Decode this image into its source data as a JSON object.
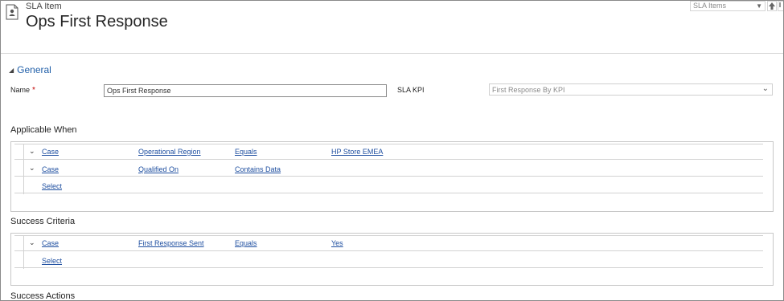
{
  "header": {
    "entity_type": "SLA Item",
    "title": "Ops First Response",
    "nav_selector": "SLA Items",
    "icon": "document-person-icon"
  },
  "general": {
    "section_label": "General",
    "name_label": "Name",
    "required_marker": "*",
    "name_value": "Ops First Response",
    "sla_kpi_label": "SLA KPI",
    "sla_kpi_value": "First Response By KPI"
  },
  "applicable_when": {
    "title": "Applicable When",
    "rows": [
      {
        "entity": "Case",
        "field": "Operational Region",
        "operator": "Equals",
        "value": "HP Store EMEA"
      },
      {
        "entity": "Case",
        "field": "Qualified On",
        "operator": "Contains Data",
        "value": ""
      }
    ],
    "select_label": "Select"
  },
  "success_criteria": {
    "title": "Success Criteria",
    "rows": [
      {
        "entity": "Case",
        "field": "First Response Sent",
        "operator": "Equals",
        "value": "Yes"
      }
    ],
    "select_label": "Select"
  },
  "success_actions": {
    "title": "Success Actions"
  },
  "colors": {
    "link": "#1f4fa0",
    "section_header": "#1f5ea8",
    "required": "#c00000",
    "border": "#c8c8c8"
  }
}
